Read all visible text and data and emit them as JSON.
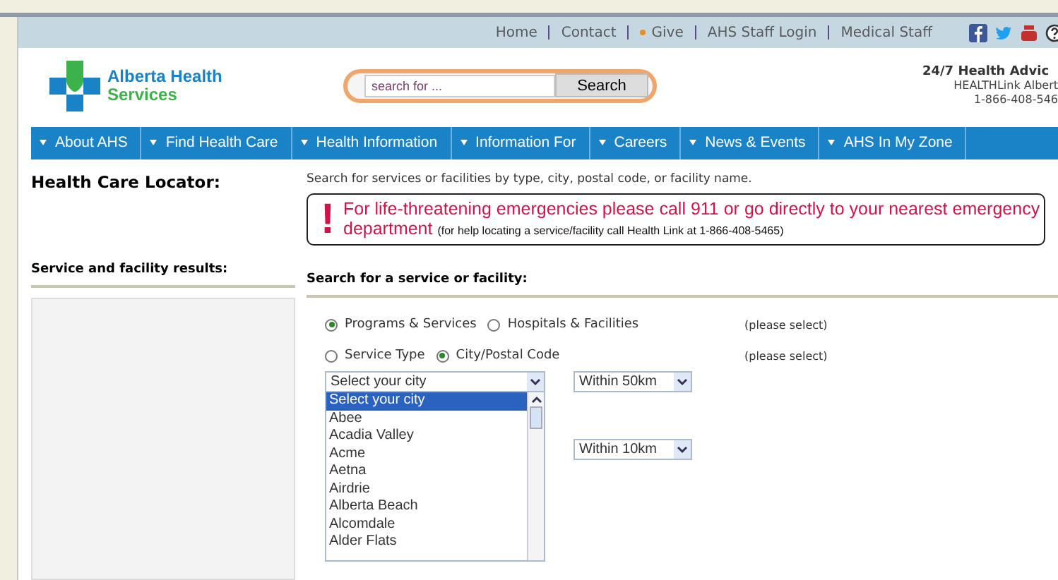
{
  "top_links": [
    {
      "label": "Home",
      "highlight": false
    },
    {
      "label": "Contact",
      "highlight": false
    },
    {
      "label": "Give",
      "highlight": true
    },
    {
      "label": "AHS Staff Login",
      "highlight": false
    },
    {
      "label": "Medical Staff",
      "highlight": false
    }
  ],
  "logo": {
    "line1": "Alberta Health",
    "line2": "Services"
  },
  "search": {
    "placeholder": "search for ...",
    "button": "Search"
  },
  "health_advice": {
    "title": "24/7 Health Advic",
    "line1": "HEALTHLink Albert",
    "line2": "1-866-408-546"
  },
  "nav": [
    "About AHS",
    "Find Health Care",
    "Health Information",
    "Information For",
    "Careers",
    "News & Events",
    "AHS In My Zone"
  ],
  "page_title": "Health Care Locator:",
  "intro": "Search for services or facilities by type, city, postal code, or facility name.",
  "emergency": {
    "mark": "!",
    "message": "For life-threatening emergencies please call 911 or go directly to your nearest emergency department",
    "note": "(for help locating a service/facility call Health Link at 1-866-408-5465)"
  },
  "results_heading": "Service and facility results:",
  "search_heading": "Search for a service or facility:",
  "radio_rows": [
    {
      "options": [
        {
          "label": "Programs & Services",
          "selected": true
        },
        {
          "label": "Hospitals & Facilities",
          "selected": false
        }
      ],
      "note": "(please select)"
    },
    {
      "options": [
        {
          "label": "Service Type",
          "selected": false
        },
        {
          "label": "City/Postal Code",
          "selected": true
        }
      ],
      "note": "(please select)"
    }
  ],
  "city_select": {
    "value": "Select your city",
    "options": [
      {
        "label": "Select your city",
        "selected": true
      },
      {
        "label": "Abee",
        "selected": false
      },
      {
        "label": "Acadia Valley",
        "selected": false
      },
      {
        "label": "Acme",
        "selected": false
      },
      {
        "label": "Aetna",
        "selected": false
      },
      {
        "label": "Airdrie",
        "selected": false
      },
      {
        "label": "Alberta Beach",
        "selected": false
      },
      {
        "label": "Alcomdale",
        "selected": false
      },
      {
        "label": "Alder Flats",
        "selected": false
      }
    ]
  },
  "distance_selects": [
    "Within 50km",
    "Within 10km"
  ]
}
